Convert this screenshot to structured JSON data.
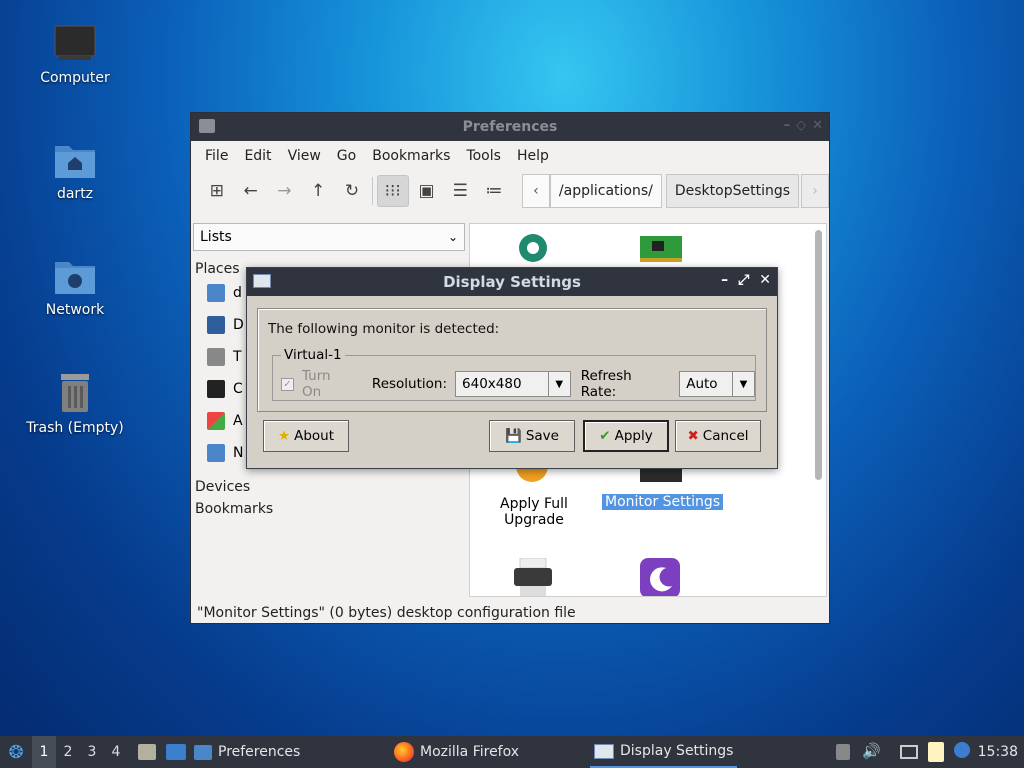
{
  "desktop": {
    "icons": [
      {
        "label": "Computer"
      },
      {
        "label": "dartz"
      },
      {
        "label": "Network"
      },
      {
        "label": "Trash (Empty)"
      }
    ]
  },
  "file_manager": {
    "title": "Preferences",
    "menu": [
      "File",
      "Edit",
      "View",
      "Go",
      "Bookmarks",
      "Tools",
      "Help"
    ],
    "path": {
      "segment1": "/applications/",
      "segment2": "DesktopSettings"
    },
    "side_combo": "Lists",
    "places_header": "Places",
    "places": [
      {
        "label": "d"
      },
      {
        "label": "D"
      },
      {
        "label": "T"
      },
      {
        "label": "C"
      },
      {
        "label": "A"
      },
      {
        "label": "N"
      }
    ],
    "devices_header": "Devices",
    "bookmarks_header": "Bookmarks",
    "items": [
      {
        "label": "Apply Full\nUpgrade"
      },
      {
        "label": "Monitor Settings"
      }
    ],
    "status": "\"Monitor Settings\" (0 bytes) desktop configuration file"
  },
  "dialog": {
    "title": "Display Settings",
    "message": "The following monitor is detected:",
    "monitor_name": "Virtual-1",
    "turn_on_label": "Turn On",
    "resolution_label": "Resolution:",
    "resolution_value": "640x480",
    "refresh_label": "Refresh Rate:",
    "refresh_value": "Auto",
    "buttons": {
      "about": "About",
      "save": "Save",
      "apply": "Apply",
      "cancel": "Cancel"
    }
  },
  "taskbar": {
    "workspaces": [
      "1",
      "2",
      "3",
      "4"
    ],
    "tasks": [
      {
        "label": "Preferences"
      },
      {
        "label": "Mozilla Firefox"
      },
      {
        "label": "Display Settings"
      }
    ],
    "clock": "15:38"
  },
  "colors": {
    "titlebar": "#2f343f",
    "selection": "#5294e2",
    "dialog_bg": "#d4d0c8"
  }
}
